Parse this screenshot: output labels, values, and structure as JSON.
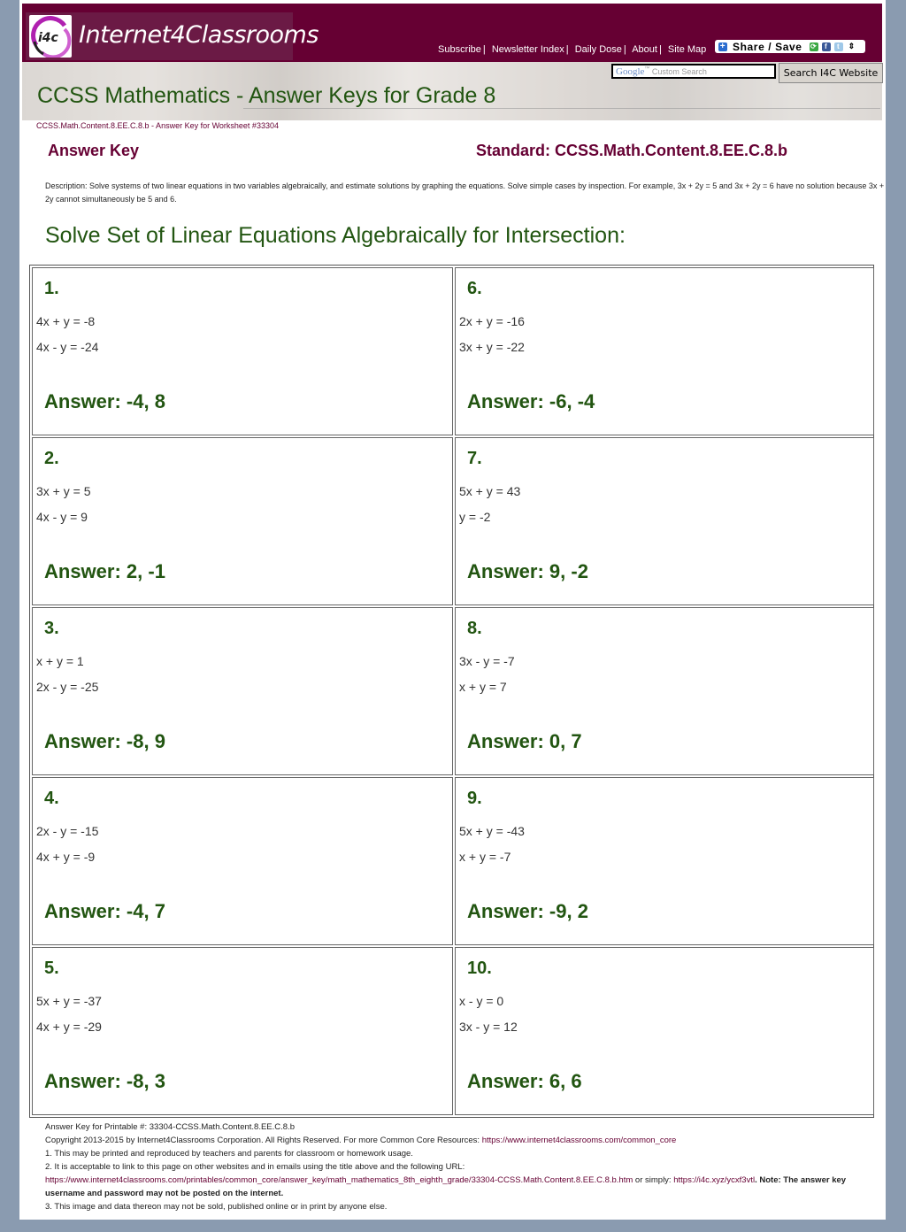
{
  "header": {
    "brand": "Internet4Classrooms",
    "logo_text": "i4c",
    "nav": [
      "Subscribe",
      "Newsletter Index",
      "Daily Dose",
      "About",
      "Site Map"
    ],
    "share_label": "Share / Save",
    "search_brand": "Google",
    "search_placeholder": "Custom Search",
    "search_button": "Search I4C Website",
    "page_title": "CCSS Mathematics - Answer Keys for Grade 8"
  },
  "breadcrumb": "CCSS.Math.Content.8.EE.C.8.b - Answer Key for Worksheet #33304",
  "answer_key_label": "Answer Key",
  "standard_label": "Standard: CCSS.Math.Content.8.EE.C.8.b",
  "description": "Description: Solve systems of two linear equations in two variables algebraically, and estimate solutions by graphing the equations. Solve simple cases by inspection. For example, 3x + 2y = 5 and 3x + 2y = 6 have no solution because 3x + 2y cannot simultaneously be 5 and 6.",
  "section_title": "Solve Set of Linear Equations Algebraically for Intersection:",
  "problems": [
    {
      "num": "1.",
      "eq1": "4x + y = -8",
      "eq2": "4x - y = -24",
      "answer": "Answer: -4, 8"
    },
    {
      "num": "6.",
      "eq1": "2x + y = -16",
      "eq2": "3x + y = -22",
      "answer": "Answer: -6, -4"
    },
    {
      "num": "2.",
      "eq1": "3x + y = 5",
      "eq2": "4x - y = 9",
      "answer": "Answer: 2, -1"
    },
    {
      "num": "7.",
      "eq1": "5x + y = 43",
      "eq2": "y = -2",
      "answer": "Answer: 9, -2"
    },
    {
      "num": "3.",
      "eq1": "x + y = 1",
      "eq2": "2x - y = -25",
      "answer": "Answer: -8, 9"
    },
    {
      "num": "8.",
      "eq1": "3x - y = -7",
      "eq2": "x + y = 7",
      "answer": "Answer: 0, 7"
    },
    {
      "num": "4.",
      "eq1": "2x - y = -15",
      "eq2": "4x + y = -9",
      "answer": "Answer: -4, 7"
    },
    {
      "num": "9.",
      "eq1": "5x + y = -43",
      "eq2": "x + y = -7",
      "answer": "Answer: -9, 2"
    },
    {
      "num": "5.",
      "eq1": "5x + y = -37",
      "eq2": "4x + y = -29",
      "answer": "Answer: -8, 3"
    },
    {
      "num": "10.",
      "eq1": "x - y = 0",
      "eq2": "3x - y = 12",
      "answer": "Answer: 6, 6"
    }
  ],
  "footer": {
    "printable": "Answer Key for Printable #: 33304-CCSS.Math.Content.8.EE.C.8.b",
    "copyright": "Copyright 2013-2015 by Internet4Classrooms Corporation. All Rights Reserved. For more Common Core Resources: ",
    "copyright_link": "https://www.internet4classrooms.com/common_core",
    "note1": "1. This may be printed and reproduced by teachers and parents for classroom or homework usage.",
    "note2": "2. It is acceptable to link to this page on other websites and in emails using the title above and the following URL:",
    "url_long": "https://www.internet4classrooms.com/printables/common_core/answer_key/math_mathematics_8th_eighth_grade/33304-CCSS.Math.Content.8.EE.C.8.b.htm",
    "or_simply": " or simply: ",
    "url_short": "https://i4c.xyz/ycxf3vtl",
    "note_bold": ". Note: The answer key username and password may not be posted on the internet.",
    "note3": "3. This image and data thereon may not be sold, published online or in print by anyone else."
  }
}
